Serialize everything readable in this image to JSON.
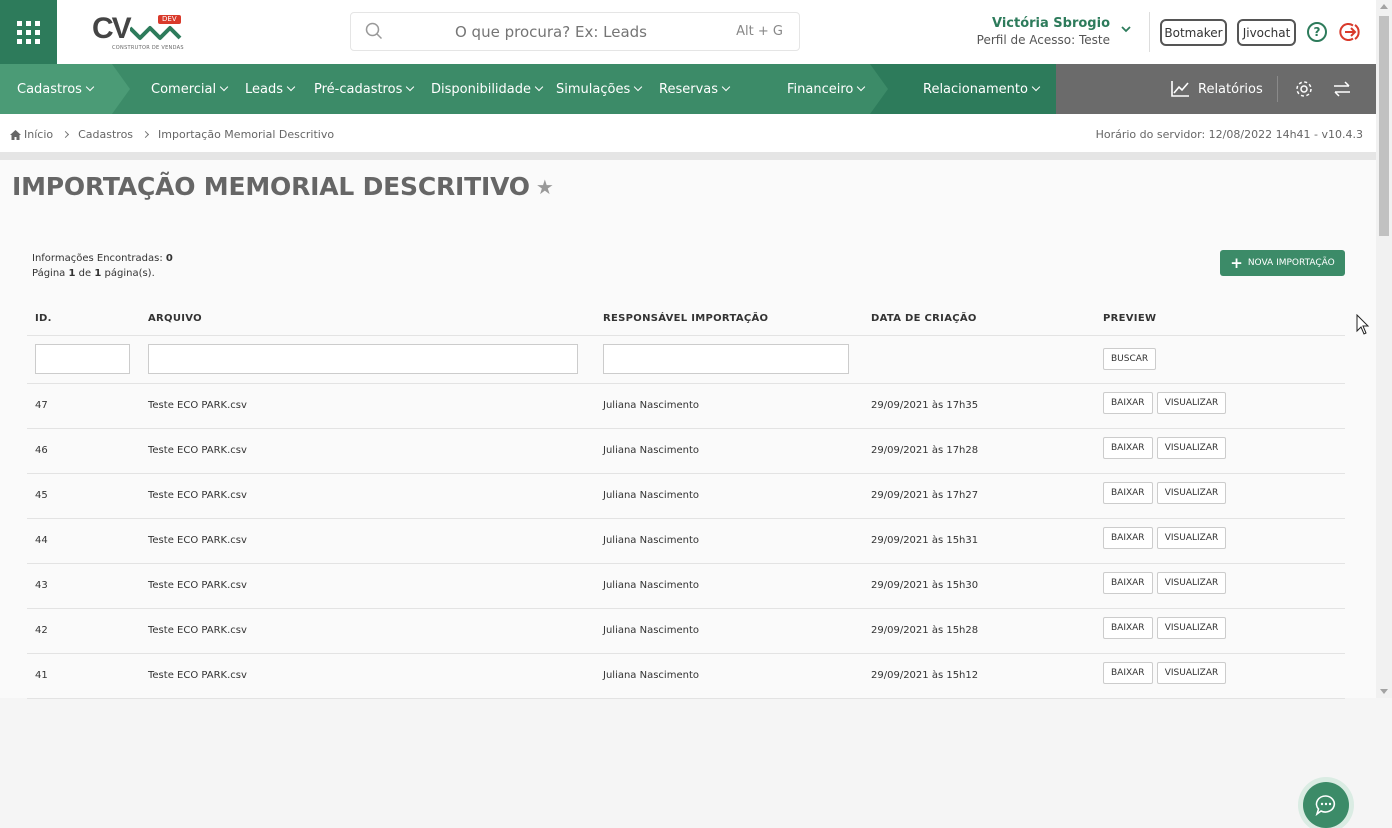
{
  "header": {
    "logo_text": "CV",
    "logo_badge": "DEV",
    "logo_tagline": "CONSTRUTOR DE VENDAS",
    "search_placeholder": "O que procura? Ex: Leads",
    "search_shortcut": "Alt + G",
    "user_name": "Victória Sbrogio",
    "user_profile": "Perfil de Acesso: Teste",
    "botmaker_label": "Botmaker",
    "jivochat_label": "Jivochat",
    "help_label": "?"
  },
  "nav": {
    "items": [
      {
        "label": "Cadastros"
      },
      {
        "label": "Comercial"
      },
      {
        "label": "Leads"
      },
      {
        "label": "Pré-cadastros"
      },
      {
        "label": "Disponibilidade"
      },
      {
        "label": "Simulações"
      },
      {
        "label": "Reservas"
      },
      {
        "label": "Financeiro"
      },
      {
        "label": "Relacionamento"
      }
    ],
    "reports_label": "Relatórios",
    "colors": {
      "primary": "#3c8b68",
      "dark": "#2d7b5b",
      "accent": "#4b9b76",
      "gray": "#6b6b6b"
    }
  },
  "breadcrumb": {
    "items": [
      "Início",
      "Cadastros",
      "Importação Memorial Descritivo"
    ],
    "server_time": "Horário do servidor: 12/08/2022 14h41 - v10.4.3"
  },
  "page": {
    "title": "IMPORTAÇÃO MEMORIAL DESCRITIVO",
    "found_label": "Informações Encontradas:",
    "found_count": "0",
    "page_prefix": "Página",
    "page_current": "1",
    "page_of": "de",
    "page_total": "1",
    "page_suffix": "página(s).",
    "new_button": "NOVA IMPORTAÇÃO"
  },
  "table": {
    "columns": [
      "ID.",
      "ARQUIVO",
      "RESPONSÁVEL IMPORTAÇÃO",
      "DATA DE CRIAÇÃO",
      "PREVIEW"
    ],
    "search_button": "BUSCAR",
    "download_label": "BAIXAR",
    "view_label": "VISUALIZAR",
    "rows": [
      {
        "id": "47",
        "file": "Teste ECO PARK.csv",
        "owner": "Juliana Nascimento",
        "date": "29/09/2021 às 17h35"
      },
      {
        "id": "46",
        "file": "Teste ECO PARK.csv",
        "owner": "Juliana Nascimento",
        "date": "29/09/2021 às 17h28"
      },
      {
        "id": "45",
        "file": "Teste ECO PARK.csv",
        "owner": "Juliana Nascimento",
        "date": "29/09/2021 às 17h27"
      },
      {
        "id": "44",
        "file": "Teste ECO PARK.csv",
        "owner": "Juliana Nascimento",
        "date": "29/09/2021 às 15h31"
      },
      {
        "id": "43",
        "file": "Teste ECO PARK.csv",
        "owner": "Juliana Nascimento",
        "date": "29/09/2021 às 15h30"
      },
      {
        "id": "42",
        "file": "Teste ECO PARK.csv",
        "owner": "Juliana Nascimento",
        "date": "29/09/2021 às 15h28"
      },
      {
        "id": "41",
        "file": "Teste ECO PARK.csv",
        "owner": "Juliana Nascimento",
        "date": "29/09/2021 às 15h12"
      }
    ]
  }
}
